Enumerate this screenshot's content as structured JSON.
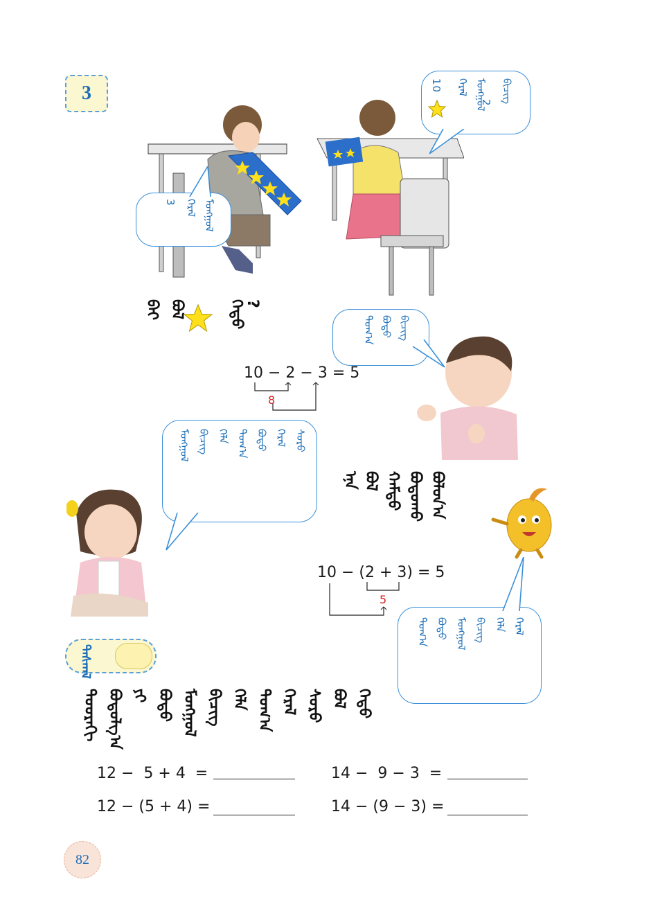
{
  "section_number": "3",
  "bubbles": {
    "girl_top": {
      "mongolian": [
        "ᠭᠡᠷᠡᠯ",
        "ᠮᠣᠩᠭᠣᠯ",
        "ᠪᠢᠴᠢᠭ"
      ],
      "number_a": "10",
      "number_b": "2"
    },
    "boy_top": {
      "mongolian": [
        "ᠭᠡᠷᠡᠯ",
        "ᠮᠣᠩᠭᠣᠯ"
      ],
      "number": "3"
    },
    "boy_right": {
      "mongolian": [
        "ᠲᠣᠭ᠎ᠠ",
        "ᠪᠣᠳᠣ",
        "ᠪᠢᠴᠢᠭ"
      ]
    },
    "girl_left": {
      "mongolian": [
        "ᠮᠣᠩᠭᠣᠯ",
        "ᠪᠢᠴᠢᠭ",
        "ᠬᠡᠯᠡ",
        "ᠲᠣᠭ᠎ᠠ",
        "ᠪᠣᠳᠣ",
        "ᠭᠡᠷᠡᠯ",
        "ᠰᠤᠷᠤ"
      ]
    },
    "potato": {
      "mongolian": [
        "ᠲᠣᠭ᠎ᠠ",
        "ᠪᠣᠳᠣ",
        "ᠮᠣᠩᠭᠣᠯ",
        "ᠪᠢᠴᠢᠭ",
        "ᠬᠡᠯᠡ",
        "ᠭᠡᠷᠡᠯ"
      ]
    }
  },
  "question_line": {
    "mongolian": [
      "ᠪᠠᠢ",
      "ᠪᠣᠯ",
      "ᠬᠡᠳᠦ",
      "?"
    ]
  },
  "middle_text": {
    "mongolian": [
      "ᠡᠨᠡ",
      "ᠪᠣᠯ",
      "ᠬᠠᠮᠲᠤ",
      "ᠪᠣᠳᠣᠬᠤ",
      "ᠪᠣᠯᠤᠨ᠎ᠠ"
    ]
  },
  "equation1": {
    "text": "10 − 2 − 3 = 5",
    "intermediate": "8"
  },
  "equation2": {
    "text": "10 − (2 + 3) = 5",
    "intermediate": "5"
  },
  "practice_label": "ᠳᠠᠰᠬᠠᠯ",
  "practice_instruction": [
    "ᠳᠣᠣᠷᠠᠬᠢ",
    "ᠪᠣᠳᠣᠯᠭ᠎ᠠ",
    "ᠶᠢ",
    "ᠪᠣᠳᠣ",
    "ᠮᠣᠩᠭᠣᠯ",
    "ᠪᠢᠴᠢᠭ",
    "ᠬᠡᠯᠡ",
    "ᠲᠣᠭ᠎ᠠ",
    "ᠭᠡᠷᠡᠯ",
    "ᠰᠤᠷᠤ",
    "ᠪᠣᠯ",
    "ᠬᠡᠳᠦ"
  ],
  "exercises": [
    {
      "left": "12 −  5 + 4  =",
      "right": "14 −  9 − 3  ="
    },
    {
      "left": "12 − (5 + 4) =",
      "right": "14 − (9 − 3) ="
    }
  ],
  "page_number": "82",
  "colors": {
    "accent_blue": "#1d6fb8",
    "red": "#d42020",
    "star": "#ffe01a"
  }
}
